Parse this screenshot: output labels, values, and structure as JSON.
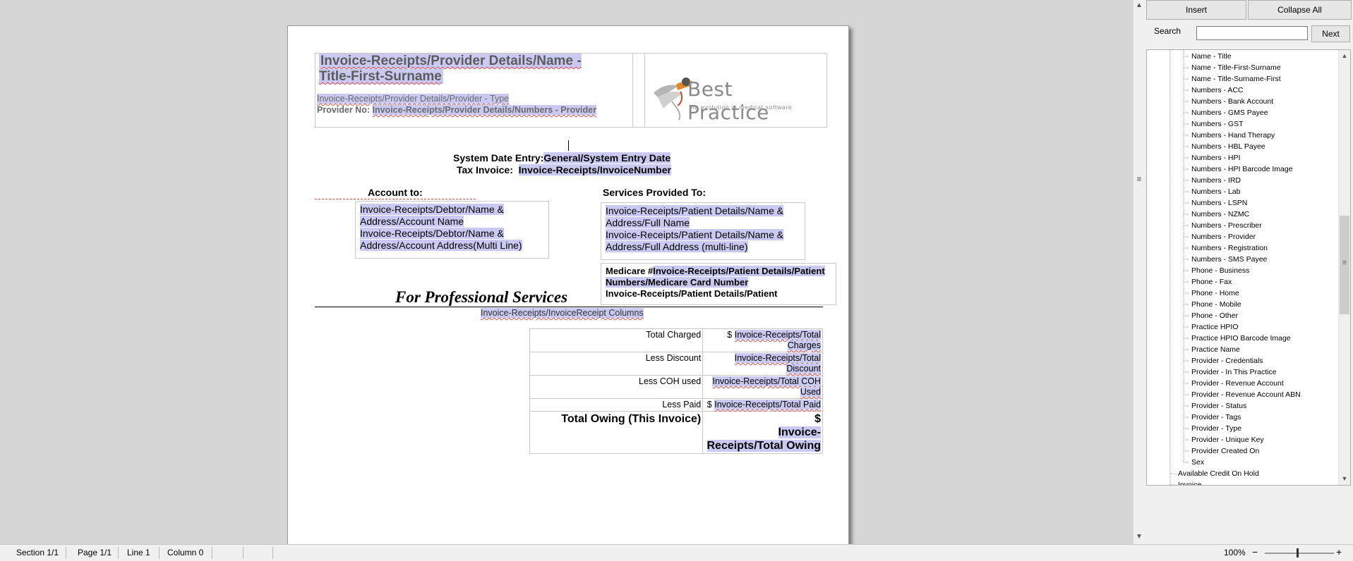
{
  "document": {
    "provider_name_field": "Invoice-Receipts/Provider Details/Name - Title-First-Surname",
    "provider_type_field": "Invoice-Receipts/Provider Details/Provider - Type",
    "provider_no_label": "Provider No:",
    "provider_no_field": "Invoice-Receipts/Provider Details/Numbers - Provider",
    "logo": {
      "brand": "Best Practice",
      "tagline": "An evolution in medical software"
    },
    "system_date_label": "System Date Entry:",
    "system_date_field": "General/System Entry Date",
    "tax_invoice_label": "Tax Invoice:",
    "tax_invoice_field": "Invoice-Receipts/InvoiceNumber",
    "account_to_label": "Account to:",
    "debtor_name_field": "Invoice-Receipts/Debtor/Name & Address/Account Name",
    "debtor_address_field": "Invoice-Receipts/Debtor/Name & Address/Account Address(Multi Line)",
    "services_to_label": "Services Provided To:",
    "patient_name_field": "Invoice-Receipts/Patient Details/Name & Address/Full Name",
    "patient_address_field": "Invoice-Receipts/Patient Details/Name & Address/Full Address (multi-line)",
    "medicare_label": "Medicare #",
    "medicare_field": "Invoice-Receipts/Patient Details/Patient Numbers/Medicare Card Number",
    "patient_details_field": "Invoice-Receipts/Patient Details/Patient",
    "professional_services": "For Professional Services",
    "invoice_columns_field": "Invoice-Receipts/InvoiceReceipt Columns",
    "totals": [
      {
        "label": "Total Charged",
        "prefix": "$ ",
        "field": "Invoice-Receipts/Total Charges"
      },
      {
        "label": "Less Discount",
        "prefix": "",
        "field": "Invoice-Receipts/Total Discount"
      },
      {
        "label": "Less COH used",
        "prefix": "",
        "field": "Invoice-Receipts/Total COH Used"
      },
      {
        "label": "Less Paid",
        "prefix": "$ ",
        "field": "Invoice-Receipts/Total Paid"
      }
    ],
    "total_owing_label": "Total Owing (This Invoice)",
    "total_owing_prefix": "$",
    "total_owing_field": "Invoice-Receipts/Total Owing"
  },
  "status_bar": {
    "section": "Section 1/1",
    "page": "Page 1/1",
    "line": "Line 1",
    "column": "Column 0",
    "zoom": "100%",
    "zoom_out": "−",
    "zoom_in": "+"
  },
  "panel": {
    "insert_button": "Insert",
    "collapse_button": "Collapse All",
    "search_label": "Search",
    "search_value": "",
    "next_button": "Next",
    "tree_items": [
      "Name - Title",
      "Name - Title-First-Surname",
      "Name - Title-Surname-First",
      "Numbers - ACC",
      "Numbers - Bank Account",
      "Numbers - GMS Payee",
      "Numbers - GST",
      "Numbers - Hand Therapy",
      "Numbers - HBL Payee",
      "Numbers - HPI",
      "Numbers - HPI Barcode Image",
      "Numbers - IRD",
      "Numbers - Lab",
      "Numbers - LSPN",
      "Numbers - NZMC",
      "Numbers - Prescriber",
      "Numbers - Provider",
      "Numbers - Registration",
      "Numbers - SMS Payee",
      "Phone - Business",
      "Phone - Fax",
      "Phone - Home",
      "Phone - Mobile",
      "Phone - Other",
      "Practice HPIO",
      "Practice HPIO Barcode Image",
      "Practice Name",
      "Provider - Credentials",
      "Provider - In This Practice",
      "Provider - Revenue Account",
      "Provider - Revenue Account ABN",
      "Provider - Status",
      "Provider - Tags",
      "Provider - Type",
      "Provider - Unique Key",
      "Provider Created On",
      "Sex"
    ],
    "tree_parent_items": [
      "Available Credit On Hold",
      "Invoice"
    ]
  }
}
